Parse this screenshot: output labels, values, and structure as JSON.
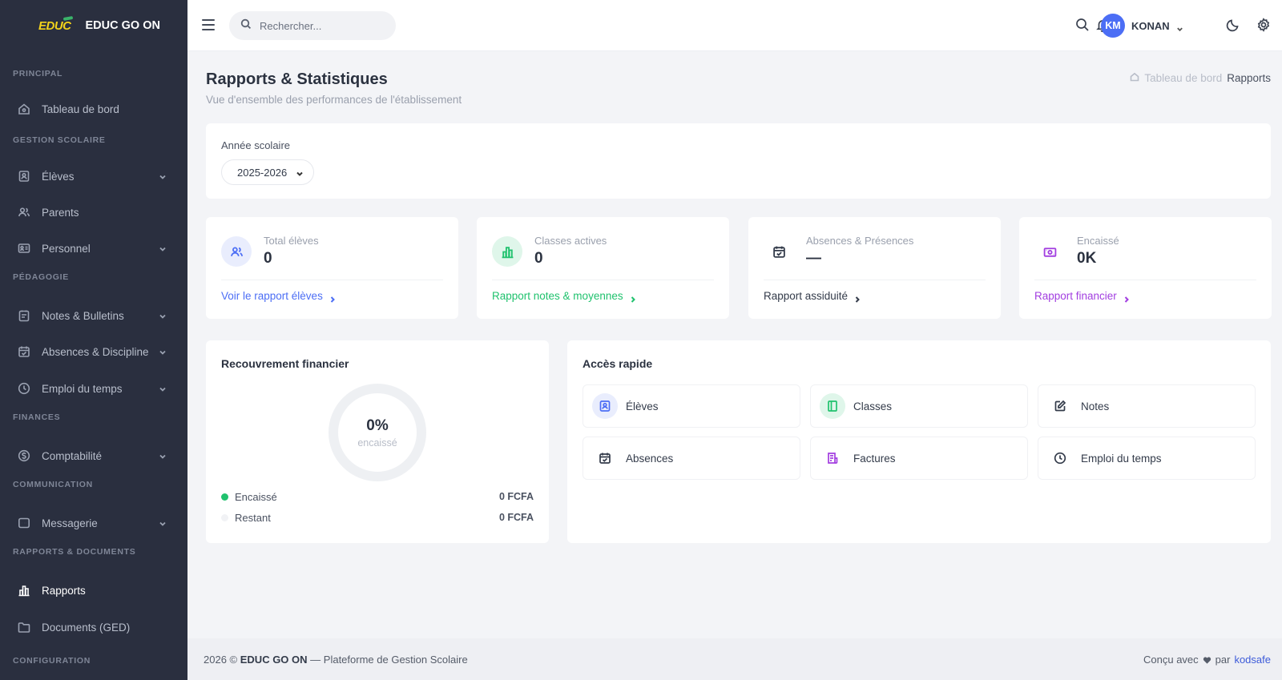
{
  "brand": {
    "logo_text": "EDUC",
    "name": "EDUC GO ON"
  },
  "sidebar": {
    "sections": [
      {
        "label": "PRINCIPAL"
      },
      {
        "label": "GESTION SCOLAIRE"
      },
      {
        "label": "PÉDAGOGIE"
      },
      {
        "label": "FINANCES"
      },
      {
        "label": "COMMUNICATION"
      },
      {
        "label": "RAPPORTS & DOCUMENTS"
      },
      {
        "label": "CONFIGURATION"
      }
    ],
    "items": [
      {
        "label": "Tableau de bord",
        "icon": "home-icon"
      },
      {
        "label": "Élèves",
        "icon": "student-icon"
      },
      {
        "label": "Parents",
        "icon": "users-icon"
      },
      {
        "label": "Personnel",
        "icon": "id-card-icon"
      },
      {
        "label": "Notes & Bulletins",
        "icon": "clipboard-icon"
      },
      {
        "label": "Absences & Discipline",
        "icon": "calendar-check-icon"
      },
      {
        "label": "Emploi du temps",
        "icon": "clock-icon"
      },
      {
        "label": "Comptabilité",
        "icon": "dollar-icon"
      },
      {
        "label": "Messagerie",
        "icon": "message-icon"
      },
      {
        "label": "Rapports",
        "icon": "bar-chart-icon",
        "active": true
      },
      {
        "label": "Documents (GED)",
        "icon": "folder-icon"
      }
    ]
  },
  "topbar": {
    "search_placeholder": "Rechercher...",
    "user": {
      "initials": "KM",
      "name": "KONAN"
    }
  },
  "page": {
    "title": "Rapports & Statistiques",
    "subtitle": "Vue d'ensemble des performances de l'établissement",
    "breadcrumb": {
      "home": "Tableau de bord",
      "current": "Rapports"
    }
  },
  "filter": {
    "label": "Année scolaire",
    "selected": "2025-2026"
  },
  "stats": [
    {
      "label": "Total élèves",
      "value": "0",
      "link": "Voir le rapport élèves",
      "color": "#4c6ef5",
      "bg": "#e9edfd"
    },
    {
      "label": "Classes actives",
      "value": "0",
      "link": "Rapport notes & moyennes",
      "color": "#20c26e",
      "bg": "#dff6ea"
    },
    {
      "label": "Absences & Présences",
      "value": "—",
      "link": "Rapport assiduité",
      "color": "#333b4a",
      "bg": "#ffffff"
    },
    {
      "label": "Encaissé",
      "value": "0K",
      "link": "Rapport financier",
      "color": "#a23ee0",
      "bg": "#ffffff"
    }
  ],
  "finance": {
    "title": "Recouvrement financier",
    "percent": "0%",
    "percent_label": "encaissé",
    "collected_fraction": 0,
    "legend": [
      {
        "name": "Encaissé",
        "value": "0 FCFA",
        "color": "#20c26e"
      },
      {
        "name": "Restant",
        "value": "0 FCFA",
        "color": "#f1f2f5"
      }
    ]
  },
  "quick_access": {
    "title": "Accès rapide",
    "tiles": [
      {
        "label": "Élèves",
        "icon": "student-icon"
      },
      {
        "label": "Classes",
        "icon": "book-icon"
      },
      {
        "label": "Notes",
        "icon": "edit-icon"
      },
      {
        "label": "Absences",
        "icon": "calendar-check-icon"
      },
      {
        "label": "Factures",
        "icon": "invoice-icon"
      },
      {
        "label": "Emploi du temps",
        "icon": "clock-icon"
      }
    ]
  },
  "footer": {
    "left_prefix": "2026 ©",
    "left_brand": "EDUC GO ON",
    "left_suffix": "— Plateforme de Gestion Scolaire",
    "right_prefix": "Conçu avec",
    "right_mid": "par",
    "right_link": "kodsafe"
  }
}
